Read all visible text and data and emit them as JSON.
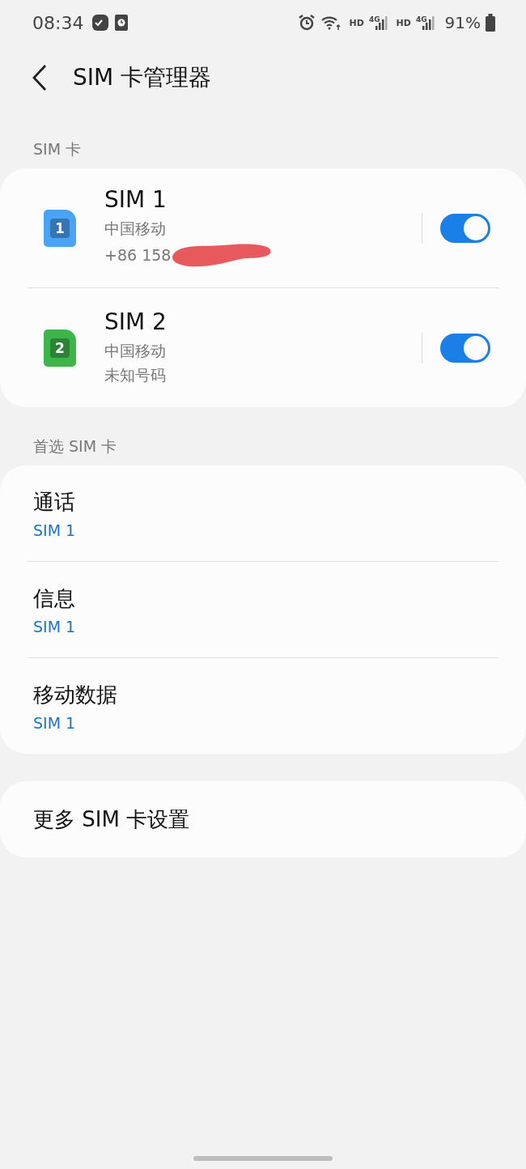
{
  "status_bar": {
    "time": "08:34",
    "network_labels": [
      "HD",
      "4G",
      "HD",
      "4G"
    ],
    "battery": "91%"
  },
  "header": {
    "title": "SIM 卡管理器"
  },
  "sim_section": {
    "label": "SIM 卡",
    "cards": [
      {
        "name": "SIM 1",
        "badge": "1",
        "color": "#4aa3f5",
        "carrier": "中国移动",
        "number": "+86 158",
        "redacted": true,
        "on": true
      },
      {
        "name": "SIM 2",
        "badge": "2",
        "color": "#3db54a",
        "carrier": "中国移动",
        "number": "未知号码",
        "redacted": false,
        "on": true
      }
    ]
  },
  "preferred_section": {
    "label": "首选 SIM 卡",
    "items": [
      {
        "label": "通话",
        "value": "SIM 1"
      },
      {
        "label": "信息",
        "value": "SIM 1"
      },
      {
        "label": "移动数据",
        "value": "SIM 1"
      }
    ]
  },
  "more": {
    "label": "更多 SIM 卡设置"
  }
}
